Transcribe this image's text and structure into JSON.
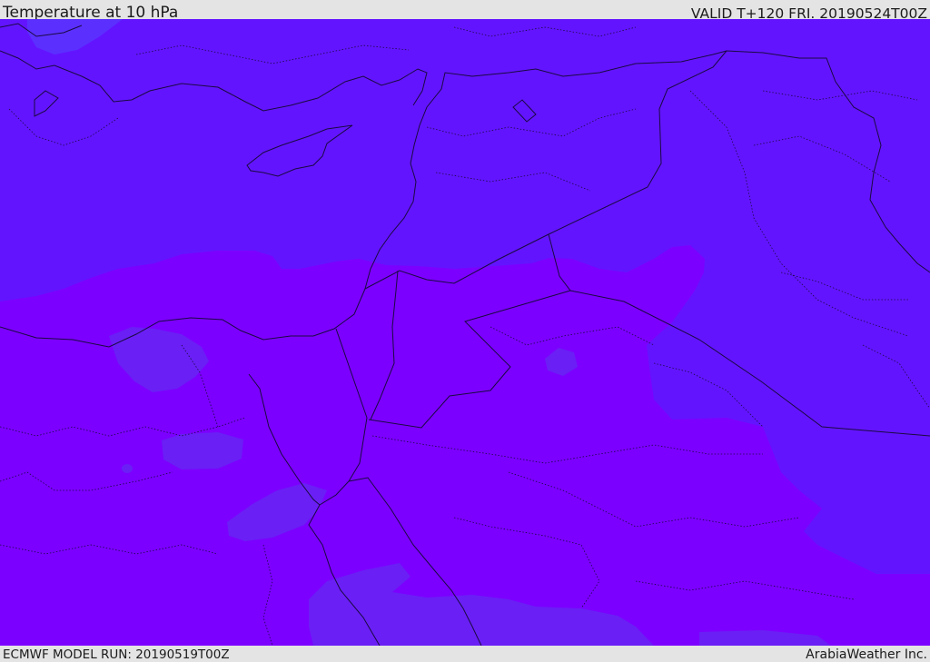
{
  "header": {
    "title": "Temperature at 10 hPa",
    "valid": "VALID T+120 FRI. 20190524T00Z"
  },
  "footer": {
    "model_run": "ECMWF MODEL RUN: 20190519T00Z",
    "brand": "ArabiaWeather Inc."
  },
  "colors": {
    "cold_zone": "#6314ff",
    "warm_zone": "#7c00ff",
    "coldest_patch": "#5b30ff",
    "borders": "#1a0a40"
  },
  "icons": [
    "temperature-field-map"
  ]
}
